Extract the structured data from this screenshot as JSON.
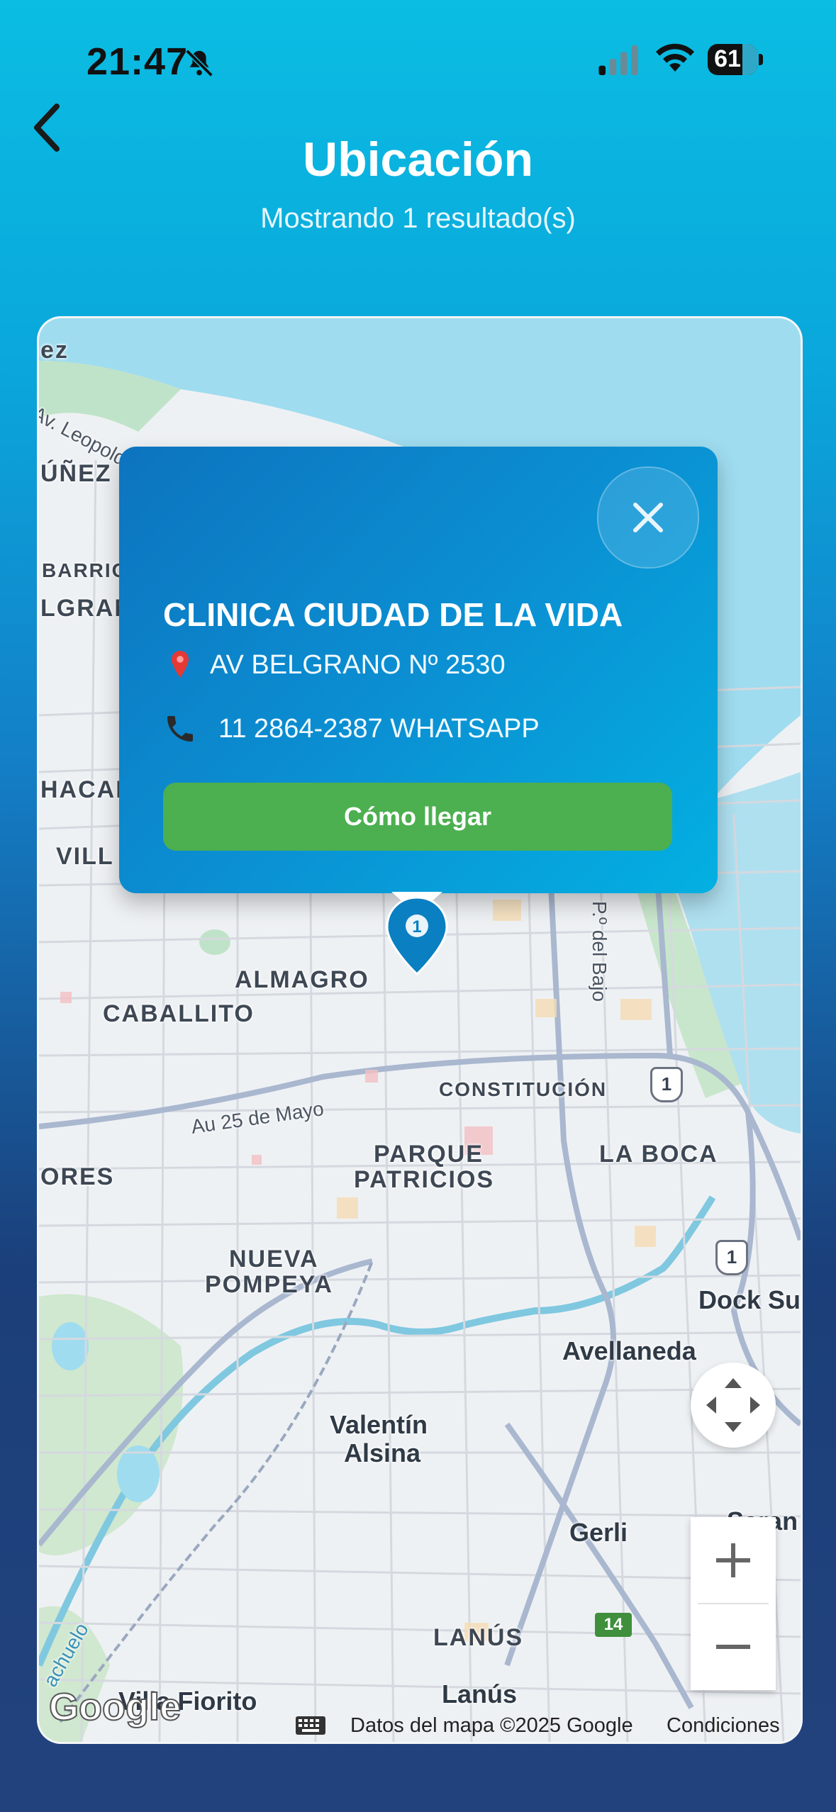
{
  "status_bar": {
    "time": "21:47",
    "battery": "61",
    "icons": [
      "bell-slash-icon",
      "cellular-signal-icon",
      "wifi-icon",
      "battery-icon"
    ]
  },
  "header": {
    "title": "Ubicación",
    "subtitle": "Mostrando 1 resultado(s)",
    "back_icon": "chevron-left-icon"
  },
  "popup": {
    "name": "CLINICA CIUDAD DE LA VIDA",
    "address": "AV BELGRANO Nº 2530",
    "phone": "11 2864-2387 WHATSAPP",
    "directions_label": "Cómo llegar",
    "close_icon": "close-icon",
    "address_icon": "pin-icon",
    "phone_icon": "phone-icon"
  },
  "marker": {
    "label": "1",
    "color": "#0a7fc2"
  },
  "map": {
    "labels": {
      "ez": "ez",
      "av_leopoldo": "Av. Leopold",
      "nunez": "ÚÑEZ",
      "barrio": "BARRIO",
      "lgran": "LGRAN",
      "hacar": "HACAR",
      "vill": "VILL",
      "almagro": "ALMAGRO",
      "caballito": "CABALLITO",
      "au_25": "Au 25 de Mayo",
      "constitucion": "CONSTITUCIÓN",
      "parque": "PARQUE",
      "patricios": "PATRICIOS",
      "la_boca": "LA BOCA",
      "ores": "ORES",
      "nueva": "NUEVA",
      "pompeya": "POMPEYA",
      "dock_sud": "Dock Su",
      "avellaneda": "Avellaneda",
      "valentin": "Valentín",
      "alsina": "Alsina",
      "gerli": "Gerli",
      "saran": "Saran",
      "lanus_upper": "LANÚS",
      "lanus": "Lanús",
      "villa_fiorito": "Villa Fiorito",
      "paseo_bajo": "P.º del Bajo",
      "riachuelo": "achuelo"
    },
    "route_badges": {
      "r1a": "1",
      "r1b": "1",
      "r14": "14"
    },
    "attribution": "Datos del mapa ©2025 Google",
    "terms": "Condiciones",
    "logo": "Google",
    "controls": {
      "recenter_icon": "recenter-arrows-icon",
      "zoom_in": "+",
      "zoom_out": "−"
    }
  },
  "colors": {
    "background_top": "#0bbde2",
    "background_bottom": "#22427d",
    "popup": "#0b8fd2",
    "button_green": "#4caf50"
  }
}
